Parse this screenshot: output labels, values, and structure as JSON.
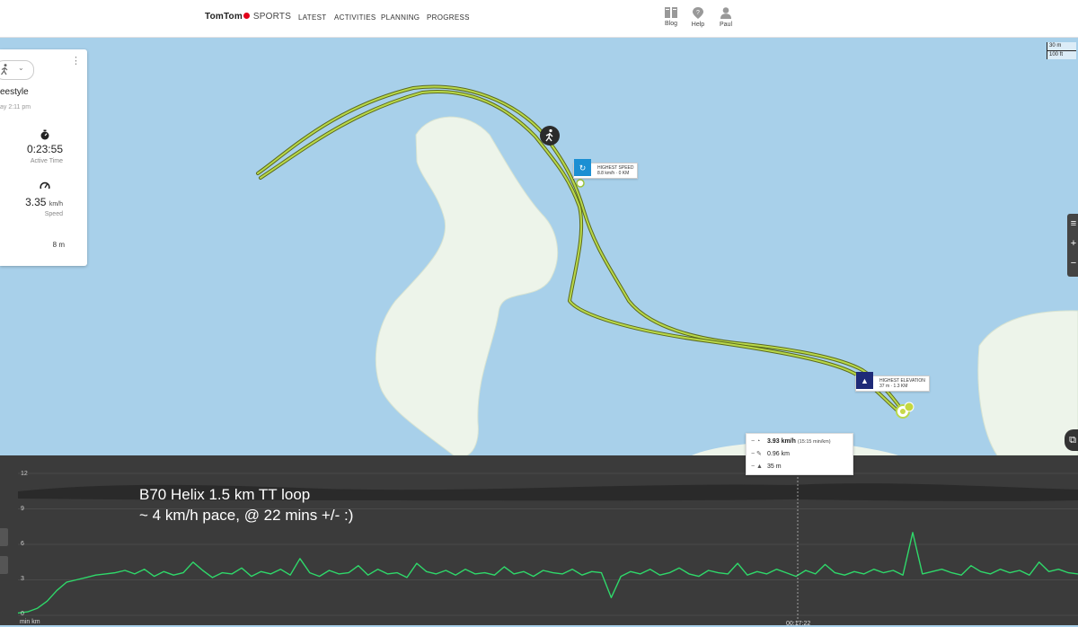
{
  "header": {
    "logo": "TomTom",
    "logo_suffix": "SPORTS",
    "nav": [
      "LATEST",
      "ACTIVITIES",
      "PLANNING",
      "PROGRESS"
    ],
    "icons": [
      {
        "icon": "blog-icon",
        "label": "Blog"
      },
      {
        "icon": "help-icon",
        "label": "Help"
      },
      {
        "icon": "user-icon",
        "label": "Paul"
      }
    ]
  },
  "map": {
    "scale_top": "30 m",
    "scale_bottom": "100 ft",
    "zoom_controls": [
      "≡",
      "+",
      "−"
    ],
    "highest_speed": {
      "title": "HIGHEST SPEED",
      "detail": "8.8 km/h · 0 KM"
    },
    "highest_elevation": {
      "title": "HIGHEST ELEVATION",
      "detail": "37 m · 1.3 KM"
    },
    "colors": {
      "water": "#a8d0ea",
      "land": "#edf4ea",
      "route": "#9cc43c",
      "speed_badge": "#1b8fd3",
      "elev_badge": "#1e2a78"
    }
  },
  "panel": {
    "title": "eestyle",
    "date": "ay 2:11 pm",
    "active_time": "0:23:55",
    "active_time_label": "Active Time",
    "speed": "3.35",
    "speed_unit": "km/h",
    "speed_label": "Speed",
    "extra": "8  m"
  },
  "chart": {
    "overlay_line1": "B70 Helix 1.5 km TT loop",
    "overlay_line2": "~ 4 km/h pace, @ 22 mins +/- :)",
    "x_start": "min km",
    "x_cursor": "00:17:22",
    "tooltip": {
      "speed": "3.93 km/h",
      "pace": "(15:15 min/km)",
      "distance": "0.96 km",
      "elevation": "35 m"
    }
  },
  "chart_data": {
    "type": "line",
    "ylim": [
      0,
      12
    ],
    "yticks": [
      "12",
      "9",
      "6",
      "3",
      "0"
    ],
    "series": [
      {
        "values": [
          0.2,
          0.3,
          0.6,
          1.2,
          2.1,
          2.8,
          3.0,
          3.2,
          3.4,
          3.5,
          3.6,
          3.8,
          3.5,
          3.9,
          3.3,
          3.7,
          3.4,
          3.6,
          4.5,
          3.8,
          3.2,
          3.6,
          3.5,
          4.0,
          3.3,
          3.7,
          3.5,
          3.9,
          3.4,
          4.8,
          3.6,
          3.3,
          3.8,
          3.5,
          3.6,
          4.2,
          3.4,
          3.9,
          3.5,
          3.6,
          3.2,
          4.4,
          3.7,
          3.5,
          3.8,
          3.4,
          3.9,
          3.5,
          3.6,
          3.4,
          4.1,
          3.5,
          3.7,
          3.3,
          3.8,
          3.6,
          3.5,
          3.9,
          3.4,
          3.7,
          3.6,
          1.5,
          3.3,
          3.7,
          3.5,
          3.9,
          3.4,
          3.6,
          4.0,
          3.5,
          3.3,
          3.8,
          3.6,
          3.5,
          4.4,
          3.4,
          3.7,
          3.5,
          3.9,
          3.6,
          3.3,
          3.8,
          3.5,
          4.3,
          3.6,
          3.4,
          3.7,
          3.5,
          3.9,
          3.6,
          3.8,
          3.4,
          7.0,
          3.5,
          3.7,
          3.9,
          3.6,
          3.4,
          4.2,
          3.7,
          3.5,
          3.9,
          3.6,
          3.8,
          3.4,
          4.5,
          3.7,
          3.9,
          3.6,
          3.5
        ]
      }
    ],
    "elevation_profile": [
      38,
      36,
      37
    ]
  }
}
